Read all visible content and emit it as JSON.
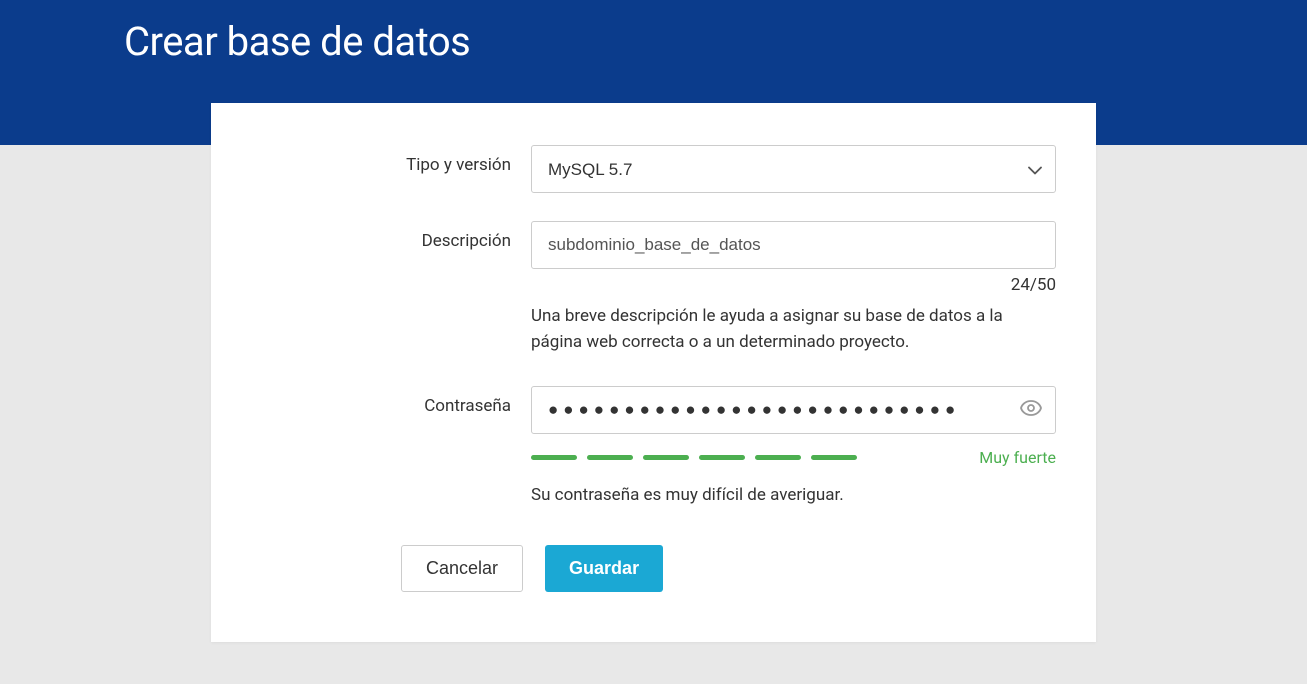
{
  "page_title": "Crear base de datos",
  "form": {
    "type_version": {
      "label": "Tipo y versión",
      "selected": "MySQL 5.7"
    },
    "description": {
      "label": "Descripción",
      "value": "subdominio_base_de_datos",
      "counter": "24/50",
      "help": "Una breve descripción le ayuda a asignar su base de datos a la página web correcta o a un determinado proyecto."
    },
    "password": {
      "label": "Contraseña",
      "value": "●●●●●●●●●●●●●●●●●●●●●●●●●●●",
      "strength_label": "Muy fuerte",
      "help": "Su contraseña es muy difícil de averiguar."
    }
  },
  "buttons": {
    "cancel": "Cancelar",
    "save": "Guardar"
  }
}
